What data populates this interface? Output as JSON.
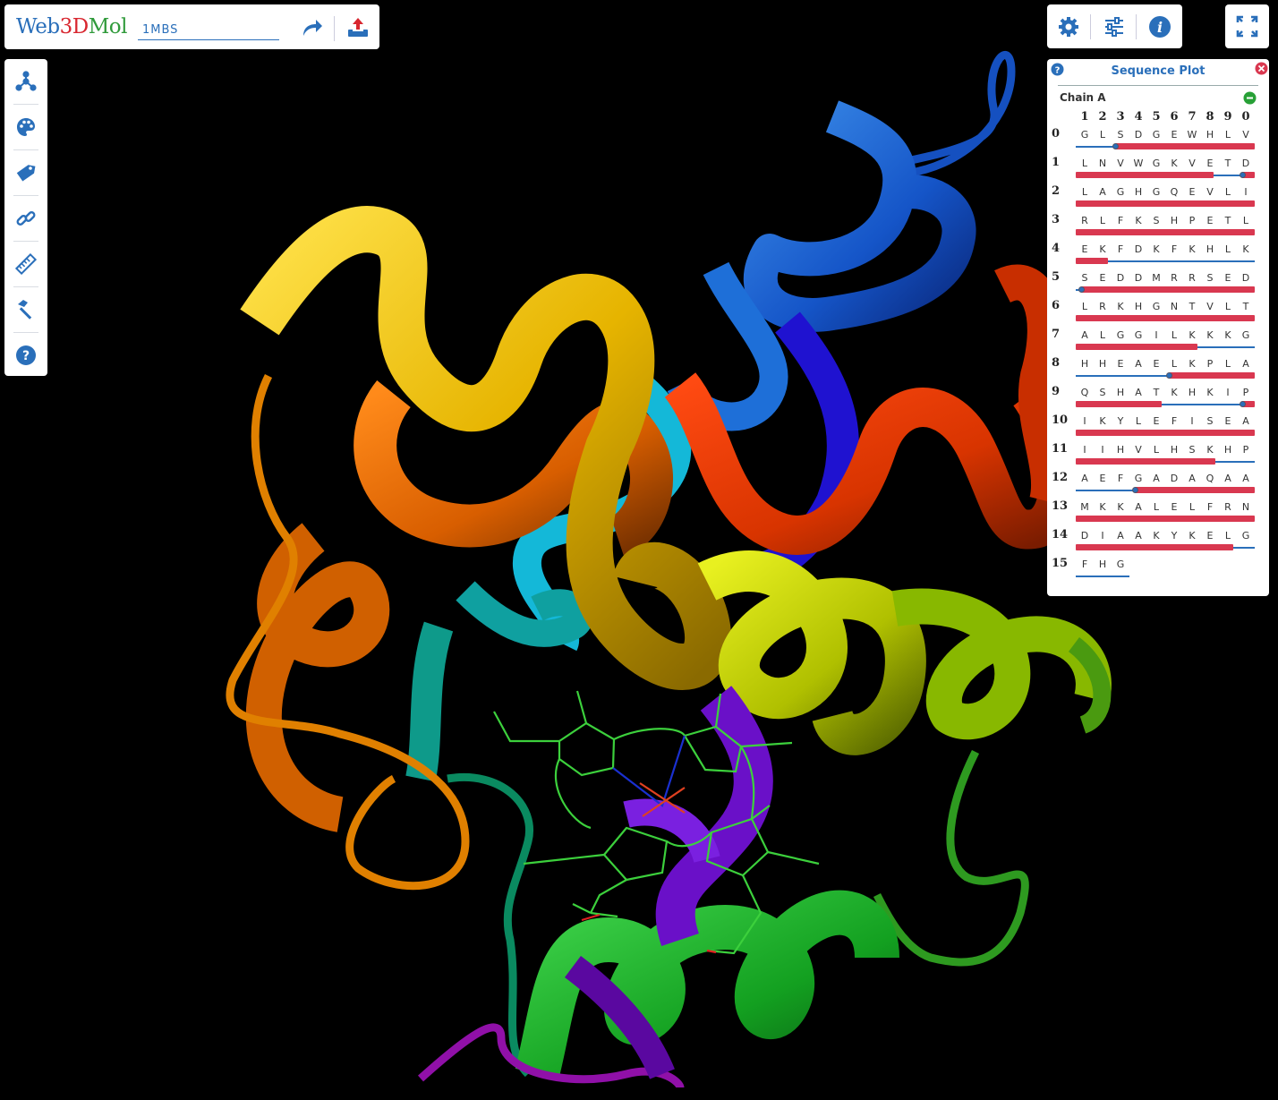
{
  "app": {
    "logo_parts": [
      "Web",
      "3D",
      "Mol"
    ]
  },
  "search": {
    "value": "1MBS"
  },
  "toolbar": {
    "submit_icon": "share-forward-icon",
    "upload_icon": "upload-icon",
    "settings_icon": "gear-icon",
    "sliders_icon": "sliders-icon",
    "info_icon": "info-icon",
    "fullscreen_icon": "expand-icon"
  },
  "left_toolbar": {
    "items": [
      "molecule-icon",
      "palette-icon",
      "label-tag-icon",
      "link-icon",
      "ruler-icon",
      "hammer-icon",
      "help-icon"
    ]
  },
  "sequence_panel": {
    "title": "Sequence Plot",
    "chain_label": "Chain A",
    "column_numbers": [
      "1",
      "2",
      "3",
      "4",
      "5",
      "6",
      "7",
      "8",
      "9",
      "0"
    ],
    "rows": [
      {
        "num": "0",
        "residues": [
          "G",
          "L",
          "S",
          "D",
          "G",
          "E",
          "W",
          "H",
          "L",
          "V"
        ],
        "line": [
          0,
          0.22
        ],
        "bar": [
          0.22,
          1
        ],
        "dots": [
          0.22
        ]
      },
      {
        "num": "1",
        "residues": [
          "L",
          "N",
          "V",
          "W",
          "G",
          "K",
          "V",
          "E",
          "T",
          "D"
        ],
        "line": [
          0.77,
          0.93
        ],
        "bar": [
          0,
          0.77
        ],
        "bar2": [
          0.93,
          1
        ],
        "dots": [
          0.93
        ]
      },
      {
        "num": "2",
        "residues": [
          "L",
          "A",
          "G",
          "H",
          "G",
          "Q",
          "E",
          "V",
          "L",
          "I"
        ],
        "line": null,
        "bar": [
          0,
          1
        ],
        "dots": []
      },
      {
        "num": "3",
        "residues": [
          "R",
          "L",
          "F",
          "K",
          "S",
          "H",
          "P",
          "E",
          "T",
          "L"
        ],
        "line": null,
        "bar": [
          0,
          1
        ],
        "dots": []
      },
      {
        "num": "4",
        "residues": [
          "E",
          "K",
          "F",
          "D",
          "K",
          "F",
          "K",
          "H",
          "L",
          "K"
        ],
        "line": [
          0.18,
          1
        ],
        "bar": [
          0,
          0.18
        ],
        "dots": []
      },
      {
        "num": "5",
        "residues": [
          "S",
          "E",
          "D",
          "D",
          "M",
          "R",
          "R",
          "S",
          "E",
          "D"
        ],
        "line": [
          0,
          0.03
        ],
        "bar": [
          0.03,
          1
        ],
        "dots": [
          0.03
        ]
      },
      {
        "num": "6",
        "residues": [
          "L",
          "R",
          "K",
          "H",
          "G",
          "N",
          "T",
          "V",
          "L",
          "T"
        ],
        "line": null,
        "bar": [
          0,
          1
        ],
        "dots": []
      },
      {
        "num": "7",
        "residues": [
          "A",
          "L",
          "G",
          "G",
          "I",
          "L",
          "K",
          "K",
          "K",
          "G"
        ],
        "line": [
          0.68,
          1
        ],
        "bar": [
          0,
          0.68
        ],
        "dots": []
      },
      {
        "num": "8",
        "residues": [
          "H",
          "H",
          "E",
          "A",
          "E",
          "L",
          "K",
          "P",
          "L",
          "A"
        ],
        "line": [
          0,
          0.52
        ],
        "bar": [
          0.52,
          1
        ],
        "dots": [
          0.52
        ]
      },
      {
        "num": "9",
        "residues": [
          "Q",
          "S",
          "H",
          "A",
          "T",
          "K",
          "H",
          "K",
          "I",
          "P"
        ],
        "line": [
          0.48,
          0.93
        ],
        "bar": [
          0,
          0.48
        ],
        "bar2": [
          0.93,
          1
        ],
        "dots": [
          0.93
        ]
      },
      {
        "num": "10",
        "residues": [
          "I",
          "K",
          "Y",
          "L",
          "E",
          "F",
          "I",
          "S",
          "E",
          "A"
        ],
        "line": null,
        "bar": [
          0,
          1
        ],
        "dots": []
      },
      {
        "num": "11",
        "residues": [
          "I",
          "I",
          "H",
          "V",
          "L",
          "H",
          "S",
          "K",
          "H",
          "P"
        ],
        "line": [
          0.78,
          1
        ],
        "bar": [
          0,
          0.78
        ],
        "dots": []
      },
      {
        "num": "12",
        "residues": [
          "A",
          "E",
          "F",
          "G",
          "A",
          "D",
          "A",
          "Q",
          "A",
          "A"
        ],
        "line": [
          0,
          0.33
        ],
        "bar": [
          0.33,
          1
        ],
        "dots": [
          0.33
        ]
      },
      {
        "num": "13",
        "residues": [
          "M",
          "K",
          "K",
          "A",
          "L",
          "E",
          "L",
          "F",
          "R",
          "N"
        ],
        "line": null,
        "bar": [
          0,
          1
        ],
        "dots": []
      },
      {
        "num": "14",
        "residues": [
          "D",
          "I",
          "A",
          "A",
          "K",
          "Y",
          "K",
          "E",
          "L",
          "G"
        ],
        "line": [
          0.88,
          1
        ],
        "bar": [
          0,
          0.88
        ],
        "dots": []
      },
      {
        "num": "15",
        "residues": [
          "F",
          "H",
          "G"
        ],
        "line": [
          0,
          0.3
        ],
        "bar": null,
        "dots": []
      }
    ]
  },
  "colors": {
    "accent": "#2a6fba",
    "bar": "#d93850",
    "logo_web": "#2a6fba",
    "logo_3d": "#d8262f",
    "logo_mol": "#2f9a3a"
  }
}
